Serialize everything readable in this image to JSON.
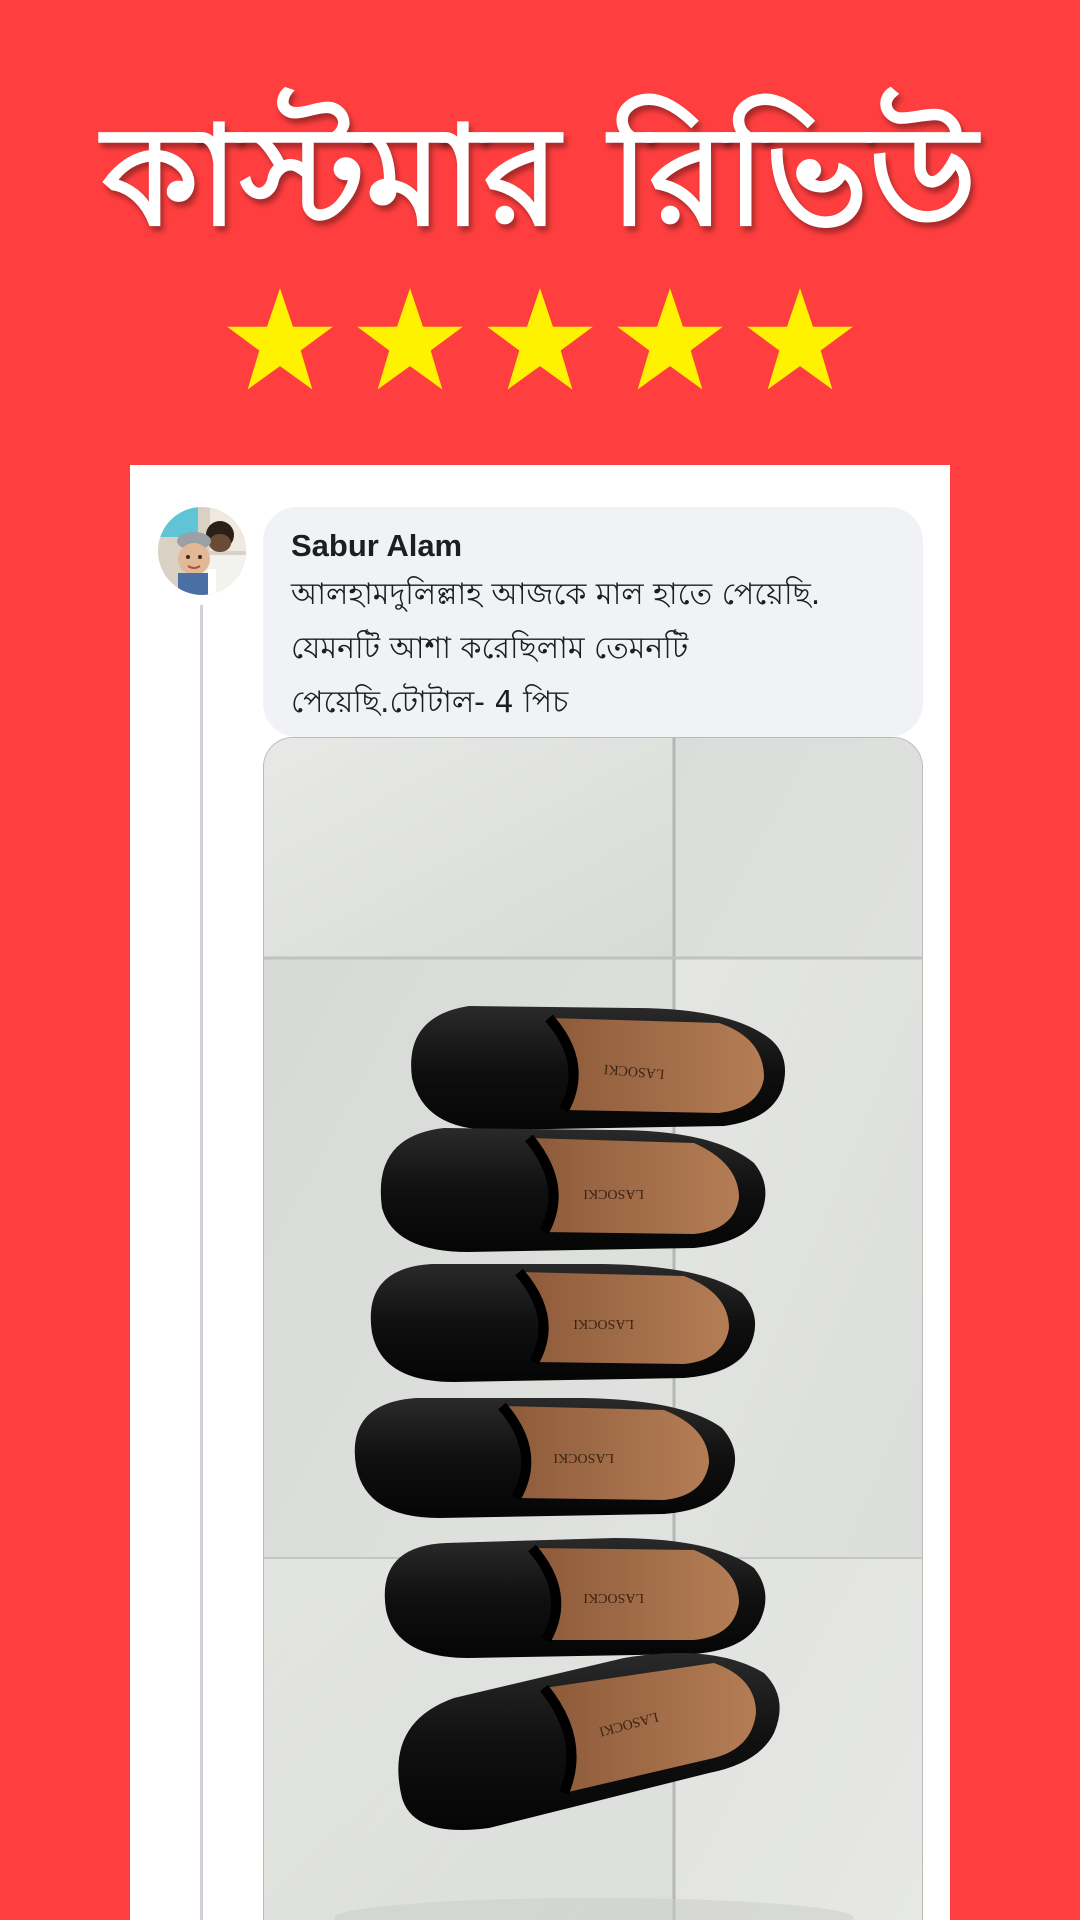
{
  "header": {
    "title": "কাস্টমার রিভিউ",
    "rating_stars": 5,
    "rating_max": 5,
    "star_color": "#fff200",
    "background_color": "#ff3f3f"
  },
  "review": {
    "author": "Sabur Alam",
    "comment": "আলহামদুলিল্লাহ আজকে মাল হাতে পেয়েছি. যেমনটি আশা করেছিলাম তেমনটি পেয়েছি.টোটাল- 4 পিচ",
    "avatar_icon": "user-avatar-photo",
    "photo_icon": "shoes-photo",
    "shoe_brand": "LASOCKI",
    "shoe_count": 6
  }
}
